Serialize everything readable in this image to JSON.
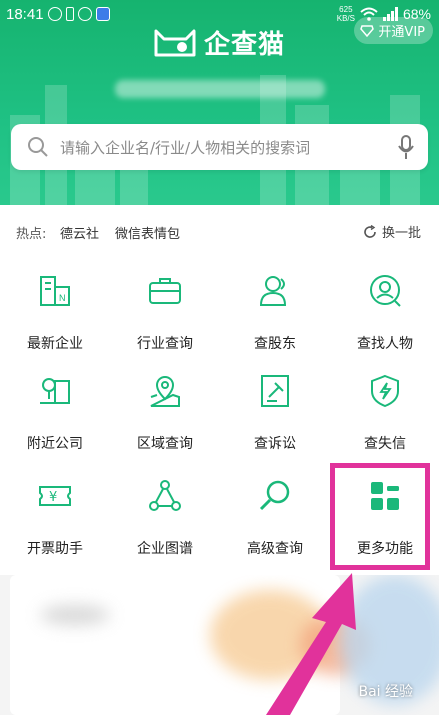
{
  "status_bar": {
    "time": "18:41",
    "speed_value": "625",
    "speed_unit": "KB/S",
    "battery": "68%"
  },
  "header": {
    "app_name": "企查猫",
    "vip_label": "开通VIP"
  },
  "search": {
    "placeholder": "请输入企业名/行业/人物相关的搜索词"
  },
  "hot": {
    "label": "热点:",
    "items": [
      "德云社",
      "微信表情包"
    ],
    "refresh_label": "换一批"
  },
  "features": [
    {
      "label": "最新企业",
      "icon": "building-icon"
    },
    {
      "label": "行业查询",
      "icon": "briefcase-icon"
    },
    {
      "label": "查股东",
      "icon": "shareholder-icon"
    },
    {
      "label": "查找人物",
      "icon": "person-search-icon"
    },
    {
      "label": "附近公司",
      "icon": "nearby-company-icon"
    },
    {
      "label": "区域查询",
      "icon": "map-pin-icon"
    },
    {
      "label": "查诉讼",
      "icon": "gavel-icon"
    },
    {
      "label": "查失信",
      "icon": "shield-bolt-icon"
    },
    {
      "label": "开票助手",
      "icon": "ticket-icon"
    },
    {
      "label": "企业图谱",
      "icon": "graph-icon"
    },
    {
      "label": "高级查询",
      "icon": "magnifier-icon"
    },
    {
      "label": "更多功能",
      "icon": "more-grid-icon"
    }
  ],
  "colors": {
    "brand_green": "#1ab87a",
    "highlight_pink": "#e1329b"
  },
  "watermark": "Bai 经验"
}
